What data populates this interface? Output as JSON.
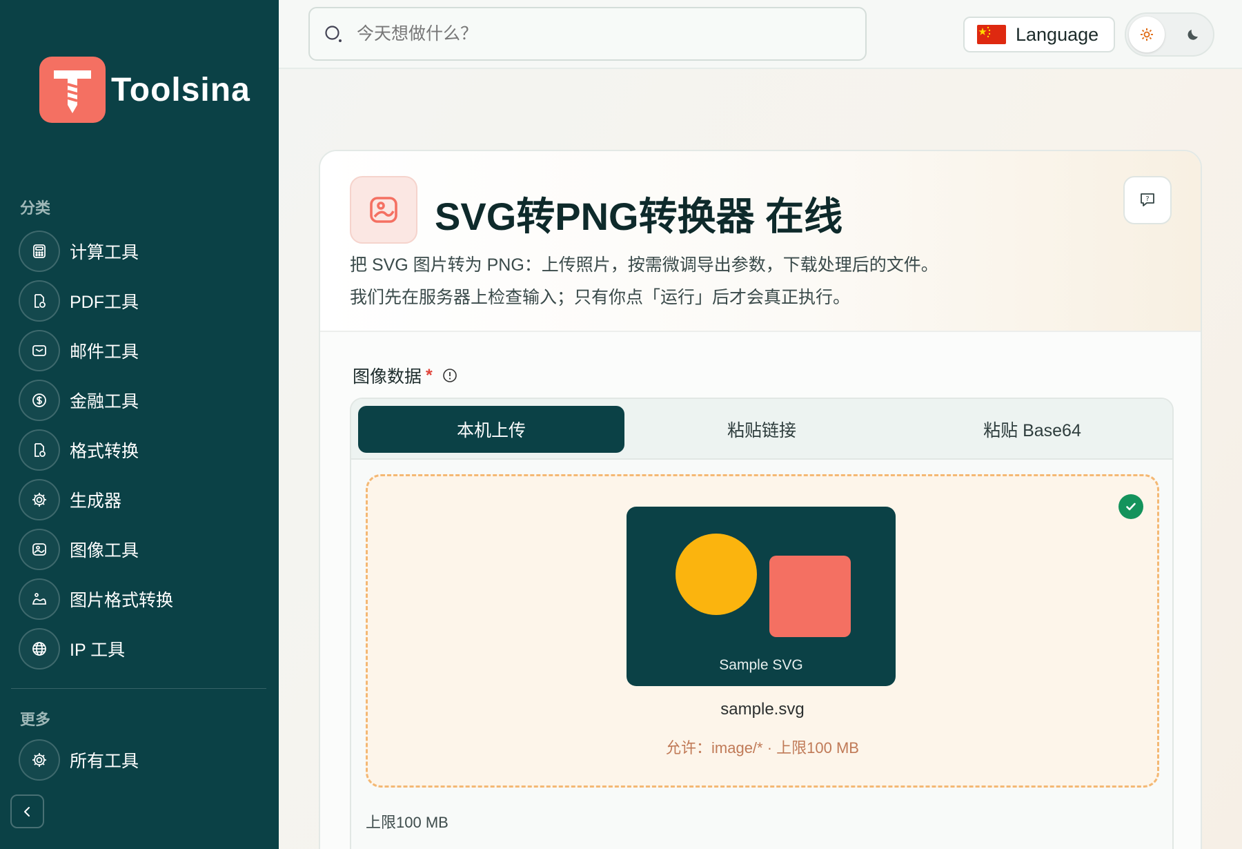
{
  "app": {
    "name": "Toolsina"
  },
  "sidebar": {
    "category_title": "分类",
    "items": [
      {
        "label": "计算工具",
        "icon": "calculator-icon"
      },
      {
        "label": "PDF工具",
        "icon": "document-icon"
      },
      {
        "label": "邮件工具",
        "icon": "mail-icon"
      },
      {
        "label": "金融工具",
        "icon": "dollar-icon"
      },
      {
        "label": "格式转换",
        "icon": "convert-icon"
      },
      {
        "label": "生成器",
        "icon": "chip-icon"
      },
      {
        "label": "图像工具",
        "icon": "image-icon"
      },
      {
        "label": "图片格式转换",
        "icon": "picture-convert-icon"
      },
      {
        "label": "IP 工具",
        "icon": "globe-icon"
      }
    ],
    "more_title": "更多",
    "more_items": [
      {
        "label": "所有工具",
        "icon": "chip-icon"
      }
    ]
  },
  "topbar": {
    "search_placeholder": "今天想做什么？",
    "language_label": "Language"
  },
  "tool": {
    "title": "SVG转PNG转换器 在线",
    "desc1": "把 SVG 图片转为 PNG：上传照片，按需微调导出参数，下载处理后的文件。",
    "desc2": "我们先在服务器上检查输入；只有你点「运行」后才会真正执行。",
    "field_label": "图像数据",
    "required_mark": "*",
    "tabs": [
      {
        "label": "本机上传",
        "active": true
      },
      {
        "label": "粘贴链接",
        "active": false
      },
      {
        "label": "粘贴 Base64",
        "active": false
      }
    ],
    "preview_label": "Sample SVG",
    "filename": "sample.svg",
    "allow_text": "允许：image/* · 上限100 MB",
    "limit_text": "上限100 MB"
  },
  "colors": {
    "sidebar_bg": "#0b4146",
    "accent": "#f47062",
    "yellow": "#fbb40e",
    "success": "#14935c",
    "dash": "#f4b874"
  }
}
